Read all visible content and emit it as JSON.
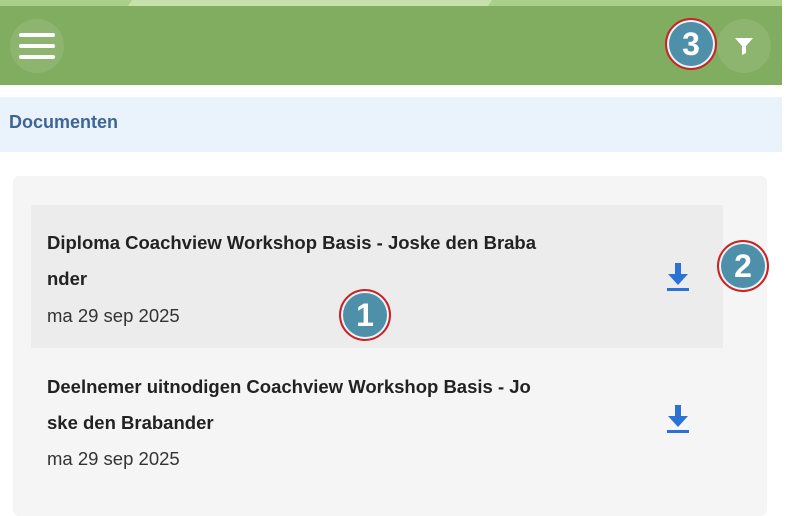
{
  "topbar": {
    "menu_icon": "hamburger-menu-icon",
    "filter_icon": "filter-funnel-icon"
  },
  "header": {
    "title": "Documenten"
  },
  "documents": [
    {
      "name": "Diploma Coachview Workshop Basis - Joske den Brabander",
      "date": "ma 29 sep 2025",
      "action_icon": "download-icon"
    },
    {
      "name": "Deelnemer uitnodigen Coachview Workshop Basis - Joske den Brabander",
      "date": "ma 29 sep 2025",
      "action_icon": "download-icon"
    }
  ],
  "annotations": [
    "1",
    "2",
    "3"
  ],
  "colors": {
    "topbar": "#80ad5f",
    "header_bg": "#eaf2fb",
    "header_text": "#3d6596",
    "download": "#2b72d6",
    "marker_fill": "#4e8faa",
    "marker_border": "#d0201f"
  }
}
